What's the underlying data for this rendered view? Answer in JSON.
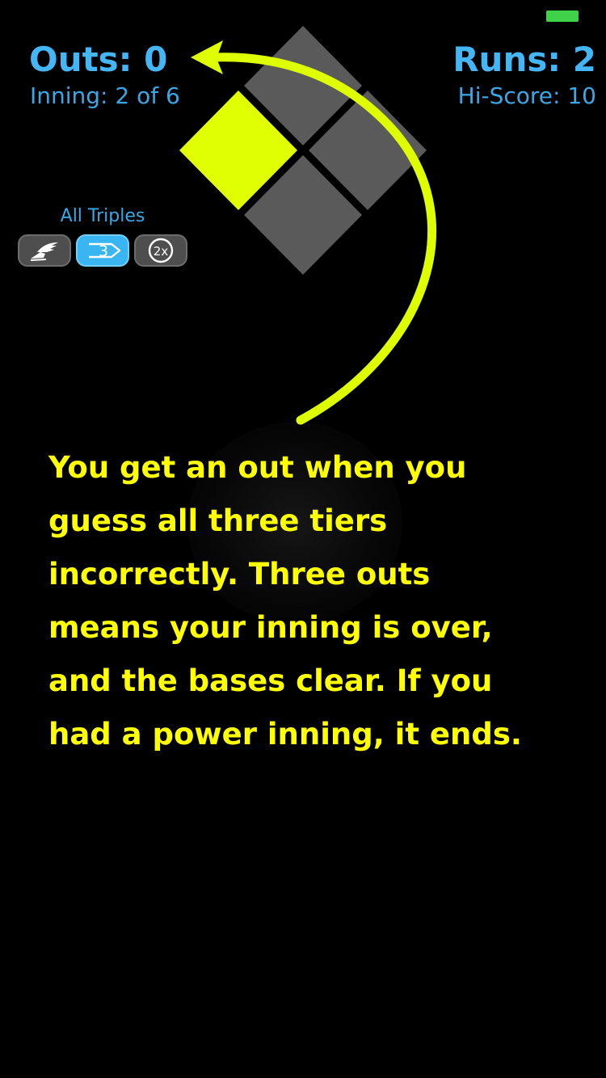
{
  "status_bar": {
    "battery_color": "#3fd14a"
  },
  "scoreboard": {
    "outs_label": "Outs: 0",
    "inning_label": "Inning: 2 of 6",
    "runs_label": "Runs: 2",
    "hiscore_label": "Hi-Score: 10"
  },
  "field": {
    "bases": [
      {
        "name": "second-base",
        "state": "empty",
        "color": "#5a5a5a"
      },
      {
        "name": "first-base",
        "state": "empty",
        "color": "#5a5a5a"
      },
      {
        "name": "third-base",
        "state": "occupied",
        "color": "#e0ff00"
      },
      {
        "name": "home-plate",
        "state": "empty",
        "color": "#5a5a5a"
      }
    ]
  },
  "powerups": {
    "label": "All Triples",
    "items": [
      {
        "name": "speed",
        "icon": "winged-shoe-icon",
        "active": false
      },
      {
        "name": "triple",
        "icon": "triple-arrow-icon",
        "glyph": "3",
        "active": true
      },
      {
        "name": "double",
        "icon": "double-multiplier-icon",
        "glyph": "2x",
        "active": false
      }
    ]
  },
  "tutorial": {
    "arrow_color": "#ddff00",
    "text_color": "#ffff00",
    "lines": [
      "You get an out when you",
      "guess all three tiers",
      "incorrectly.  Three outs",
      "means your inning is over,",
      "and the bases clear.  If you",
      "had a power inning, it ends."
    ]
  }
}
